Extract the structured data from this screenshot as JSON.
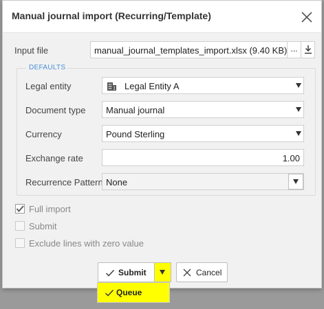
{
  "dialog": {
    "title": "Manual journal import (Recurring/Template)",
    "close_icon": "close-icon"
  },
  "input_file": {
    "label": "Input file",
    "value": "manual_journal_templates_import.xlsx (9.40 KB)",
    "browse_label": "...",
    "download_icon": "download-icon"
  },
  "defaults": {
    "legend": "DEFAULTS",
    "legal_entity": {
      "label": "Legal entity",
      "value": "Legal Entity A",
      "icon": "building-icon"
    },
    "document_type": {
      "label": "Document type",
      "value": "Manual journal"
    },
    "currency": {
      "label": "Currency",
      "value": "Pound Sterling"
    },
    "exchange_rate": {
      "label": "Exchange rate",
      "value": "1.00"
    },
    "recurrence_pattern": {
      "label": "Recurrence Pattern",
      "value": "None"
    }
  },
  "options": {
    "full_import": {
      "label": "Full import",
      "checked": true
    },
    "submit": {
      "label": "Submit",
      "checked": false
    },
    "exclude_zero": {
      "label": "Exclude lines with zero value",
      "checked": false
    }
  },
  "actions": {
    "submit_label": "Submit",
    "cancel_label": "Cancel",
    "menu_items": [
      {
        "label": "Queue"
      }
    ]
  },
  "colors": {
    "highlight": "#ffff00",
    "legend": "#4a90d9",
    "overlay": "#9a9a9a"
  }
}
